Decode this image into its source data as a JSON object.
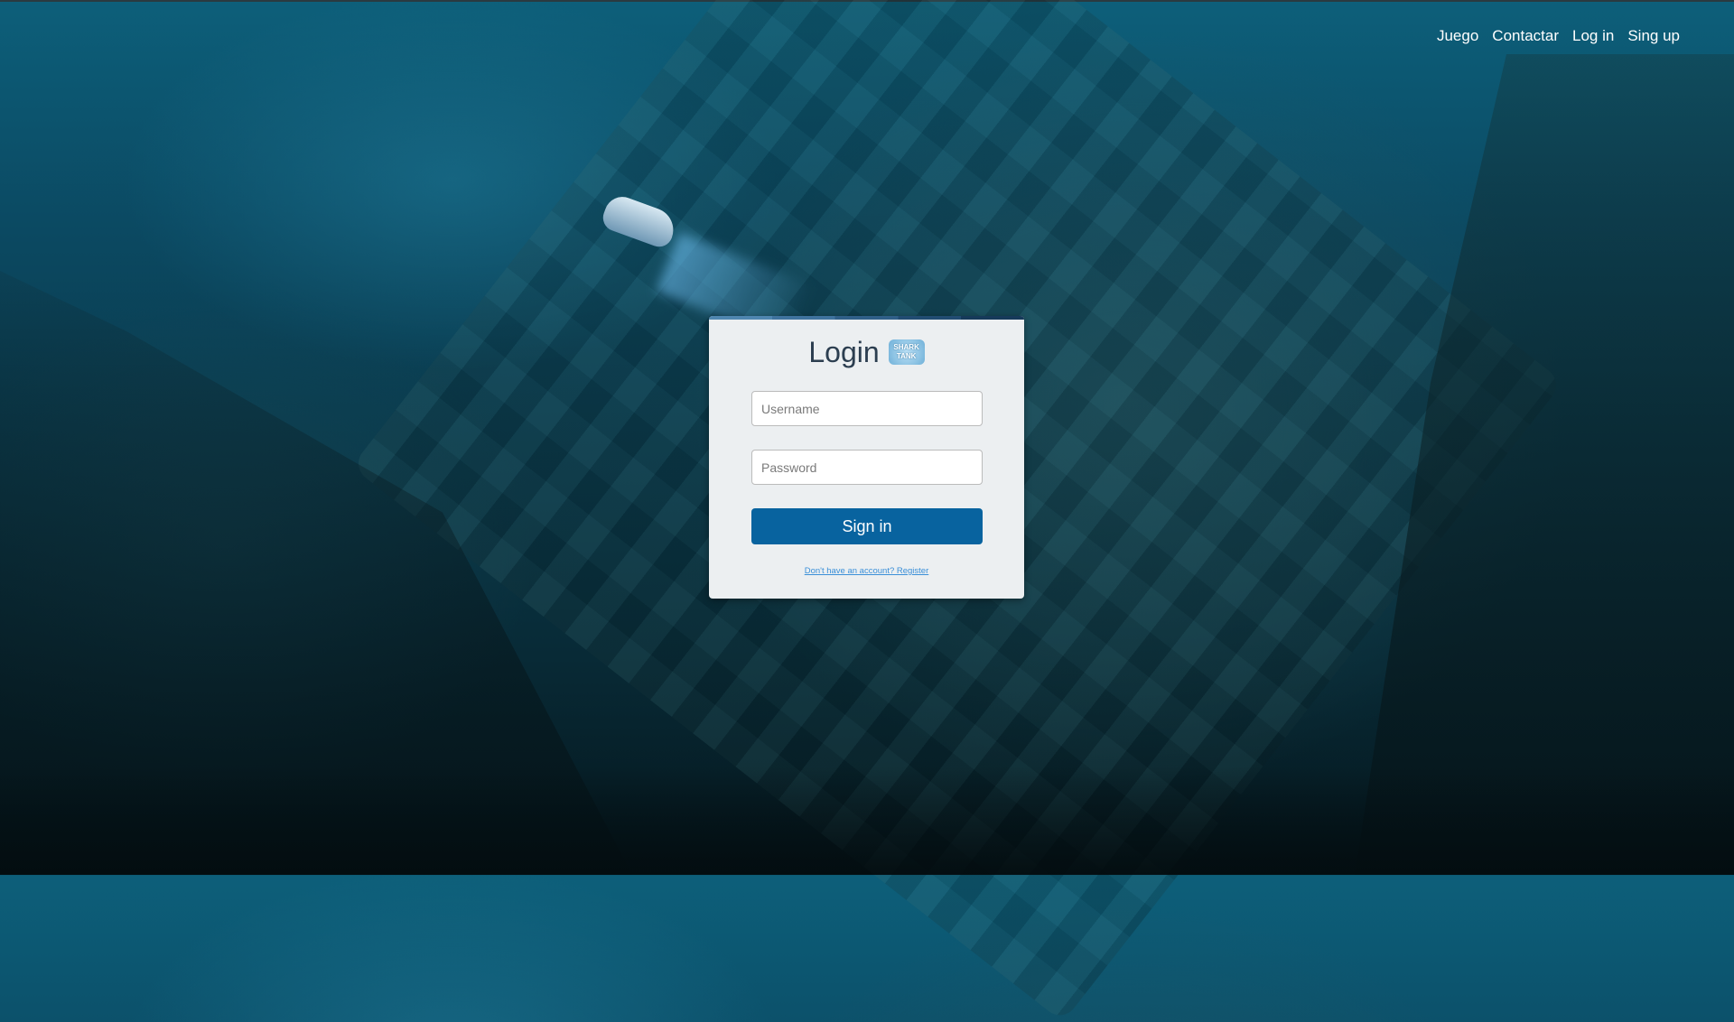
{
  "nav": {
    "items": [
      {
        "label": "Juego"
      },
      {
        "label": "Contactar"
      },
      {
        "label": "Log in"
      },
      {
        "label": "Sing up"
      }
    ]
  },
  "login": {
    "title": "Login",
    "logo_text": "SHARK TANK",
    "username_placeholder": "Username",
    "password_placeholder": "Password",
    "submit_label": "Sign in",
    "register_link": "Don't have an account? Register"
  },
  "colors": {
    "button": "#08639f",
    "card": "#eceff1",
    "link": "#3a8fd8"
  }
}
